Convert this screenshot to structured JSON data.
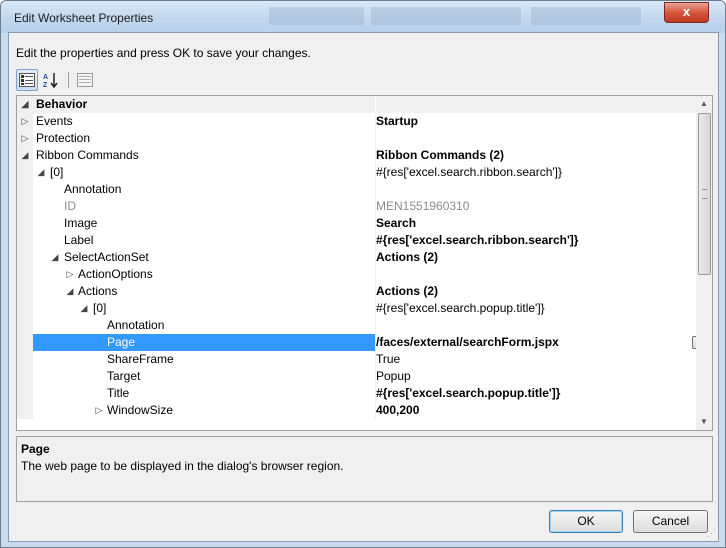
{
  "window": {
    "title": "Edit Worksheet Properties",
    "close_label": "x"
  },
  "instruction": "Edit the properties and press OK to save your changes.",
  "toolbar": {
    "categorized_icon": "categorized-icon",
    "alphabetical_icon": "alphabetical-icon",
    "property_pages_icon": "property-pages-icon"
  },
  "grid": {
    "rows": [
      {
        "toggle": "◢",
        "name": "Behavior",
        "value": ""
      },
      {
        "toggle": "▷",
        "name": "Events",
        "value": "Startup"
      },
      {
        "toggle": "▷",
        "name": "Protection",
        "value": ""
      },
      {
        "toggle": "◢",
        "name": "Ribbon Commands",
        "value": "Ribbon Commands (2)"
      },
      {
        "toggle": "◢",
        "name": "[0]",
        "value": "#{res['excel.search.ribbon.search']}"
      },
      {
        "toggle": "",
        "name": "Annotation",
        "value": ""
      },
      {
        "toggle": "",
        "name": "ID",
        "value": "MEN1551960310"
      },
      {
        "toggle": "",
        "name": "Image",
        "value": "Search"
      },
      {
        "toggle": "",
        "name": "Label",
        "value": "#{res['excel.search.ribbon.search']}"
      },
      {
        "toggle": "◢",
        "name": "SelectActionSet",
        "value": "Actions (2)"
      },
      {
        "toggle": "▷",
        "name": "ActionOptions",
        "value": ""
      },
      {
        "toggle": "◢",
        "name": "Actions",
        "value": "Actions (2)"
      },
      {
        "toggle": "◢",
        "name": "[0]",
        "value": "#{res['excel.search.popup.title']}"
      },
      {
        "toggle": "",
        "name": "Annotation",
        "value": ""
      },
      {
        "toggle": "",
        "name": "Page",
        "value": "/faces/external/searchForm.jspx",
        "button": "..."
      },
      {
        "toggle": "",
        "name": "ShareFrame",
        "value": "True"
      },
      {
        "toggle": "",
        "name": "Target",
        "value": "Popup"
      },
      {
        "toggle": "",
        "name": "Title",
        "value": "#{res['excel.search.popup.title']}"
      },
      {
        "toggle": "▷",
        "name": "WindowSize",
        "value": "400,200"
      }
    ]
  },
  "description": {
    "title": "Page",
    "text": "The web page to be displayed in the dialog's browser region."
  },
  "buttons": {
    "ok": "OK",
    "cancel": "Cancel"
  },
  "colors": {
    "selection": "#3399ff",
    "panel": "#f0f0f0",
    "accent": "#c0391f"
  }
}
